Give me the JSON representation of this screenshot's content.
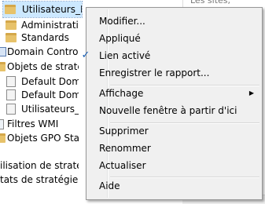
{
  "tree": {
    "items": [
      {
        "label": "Utilisateurs_IF",
        "icon": "folder-icon"
      },
      {
        "label": "Administrati",
        "icon": "folder-icon"
      },
      {
        "label": "Standards",
        "icon": "folder-icon"
      },
      {
        "label": "Domain Contro",
        "icon": "domain-icon"
      },
      {
        "label": "Objets de straté",
        "icon": "folder-icon"
      },
      {
        "label": "Default Dom",
        "icon": "gpo-icon"
      },
      {
        "label": "Default Dom",
        "icon": "gpo-icon"
      },
      {
        "label": "Utilisateurs_",
        "icon": "gpo-icon"
      },
      {
        "label": "Filtres WMI",
        "icon": "wmi-icon"
      },
      {
        "label": "Objets GPO Star",
        "icon": "folder-icon"
      }
    ],
    "bottom_lines": [
      "ilisation de stratég",
      "tats de stratégie d"
    ]
  },
  "right_pane": {
    "header": "Les sites, domaines e"
  },
  "context_menu": {
    "items": [
      {
        "label": "Modifier..."
      },
      {
        "label": "Appliqué"
      },
      {
        "label": "Lien activé",
        "checked": true,
        "check_glyph": "✓"
      },
      {
        "label": "Enregistrer le rapport..."
      },
      {
        "label": "Affichage",
        "submenu_glyph": "▶"
      },
      {
        "label": "Nouvelle fenêtre à partir d'ici"
      },
      {
        "label": "Supprimer"
      },
      {
        "label": "Renommer"
      },
      {
        "label": "Actualiser"
      },
      {
        "label": "Aide"
      }
    ]
  },
  "colors": {
    "selection": "#cce8ff",
    "menu_bg": "#f0f0f0",
    "check": "#1a5fb4"
  }
}
